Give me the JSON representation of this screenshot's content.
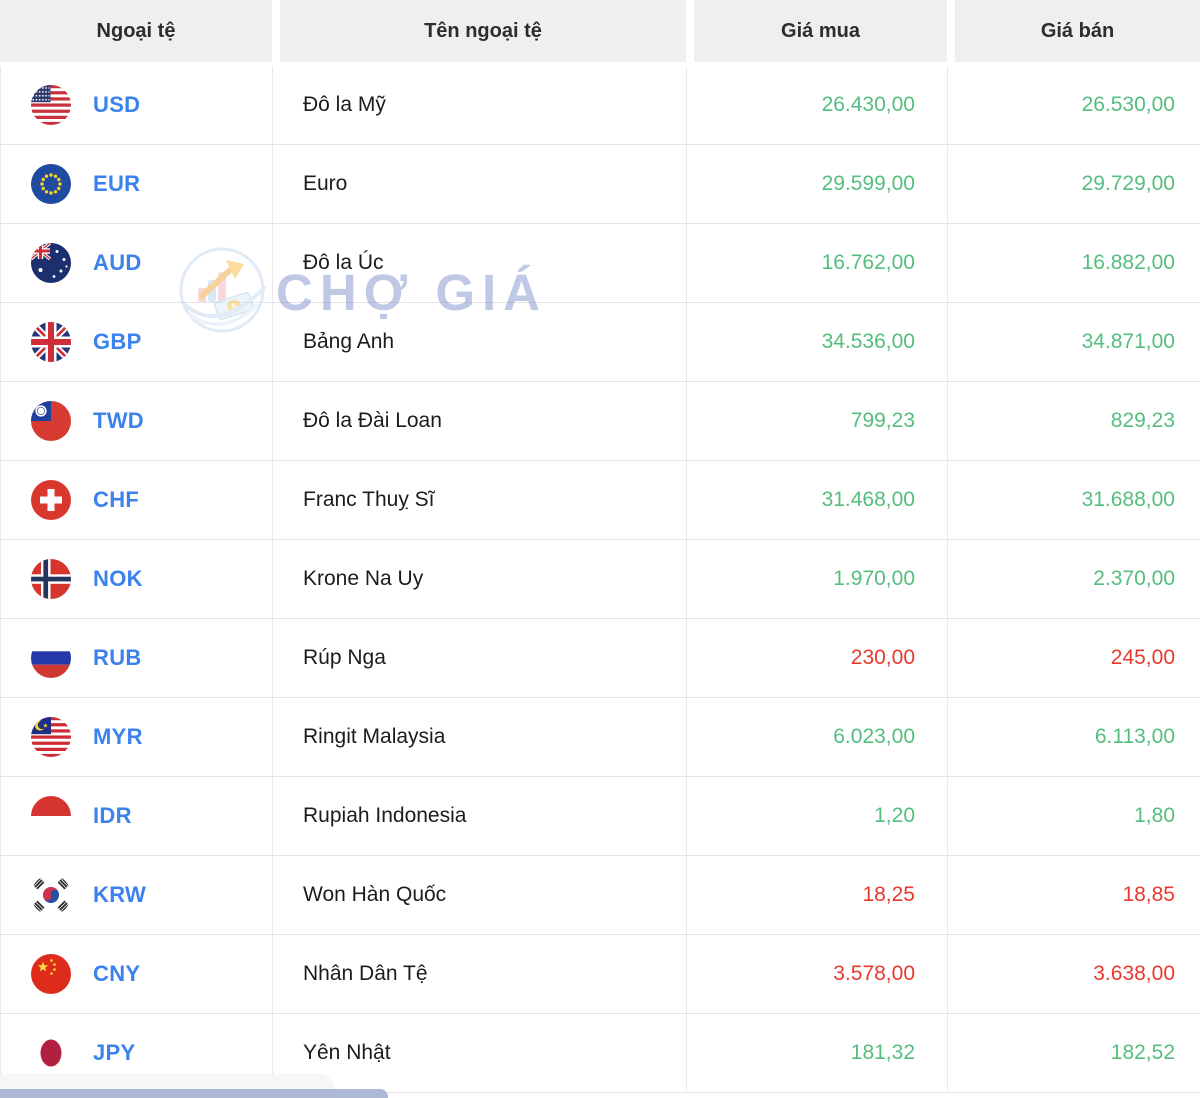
{
  "watermark": {
    "brand": "CHỢ GIÁ"
  },
  "colors": {
    "positive": "#55bd7e",
    "negative": "#e8392e",
    "currency_code_link": "#3c82ee",
    "header_background": "#efefef"
  },
  "table": {
    "columns": [
      "Ngoại tệ",
      "Tên ngoại tệ",
      "Giá mua",
      "Giá bán"
    ],
    "rows": [
      {
        "code": "USD",
        "flag": "usa-flag-icon",
        "name": "Đô la Mỹ",
        "buy": "26.430,00",
        "sell": "26.530,00",
        "trend": "up"
      },
      {
        "code": "EUR",
        "flag": "eu-flag-icon",
        "name": "Euro",
        "buy": "29.599,00",
        "sell": "29.729,00",
        "trend": "up"
      },
      {
        "code": "AUD",
        "flag": "australia-flag-icon",
        "name": "Đô la Úc",
        "buy": "16.762,00",
        "sell": "16.882,00",
        "trend": "up"
      },
      {
        "code": "GBP",
        "flag": "uk-flag-icon",
        "name": "Bảng Anh",
        "buy": "34.536,00",
        "sell": "34.871,00",
        "trend": "up"
      },
      {
        "code": "TWD",
        "flag": "taiwan-flag-icon",
        "name": "Đô la Đài Loan",
        "buy": "799,23",
        "sell": "829,23",
        "trend": "up"
      },
      {
        "code": "CHF",
        "flag": "switzerland-flag-icon",
        "name": "Franc Thuỵ Sĩ",
        "buy": "31.468,00",
        "sell": "31.688,00",
        "trend": "up"
      },
      {
        "code": "NOK",
        "flag": "norway-flag-icon",
        "name": "Krone Na Uy",
        "buy": "1.970,00",
        "sell": "2.370,00",
        "trend": "up"
      },
      {
        "code": "RUB",
        "flag": "russia-flag-icon",
        "name": "Rúp Nga",
        "buy": "230,00",
        "sell": "245,00",
        "trend": "down"
      },
      {
        "code": "MYR",
        "flag": "malaysia-flag-icon",
        "name": "Ringit Malaysia",
        "buy": "6.023,00",
        "sell": "6.113,00",
        "trend": "up"
      },
      {
        "code": "IDR",
        "flag": "indonesia-flag-icon",
        "name": "Rupiah Indonesia",
        "buy": "1,20",
        "sell": "1,80",
        "trend": "up"
      },
      {
        "code": "KRW",
        "flag": "south-korea-flag-icon",
        "name": "Won Hàn Quốc",
        "buy": "18,25",
        "sell": "18,85",
        "trend": "down"
      },
      {
        "code": "CNY",
        "flag": "china-flag-icon",
        "name": "Nhân Dân Tệ",
        "buy": "3.578,00",
        "sell": "3.638,00",
        "trend": "down"
      },
      {
        "code": "JPY",
        "flag": "japan-flag-icon",
        "name": "Yên Nhật",
        "buy": "181,32",
        "sell": "182,52",
        "trend": "up"
      }
    ]
  }
}
